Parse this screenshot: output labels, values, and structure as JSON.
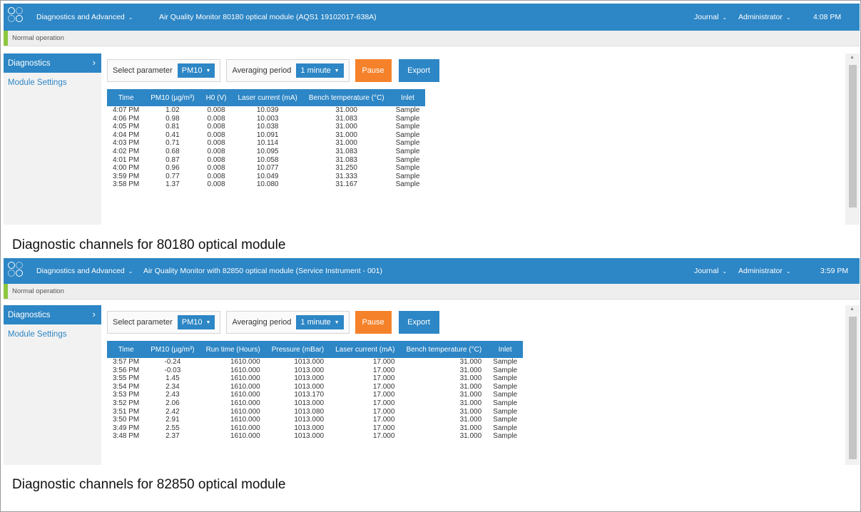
{
  "colors": {
    "accent": "#2d86c5",
    "pause": "#f5822a",
    "status_ok": "#8dc63f"
  },
  "panels": [
    {
      "topbar": {
        "menu": "Diagnostics and Advanced",
        "title": "Air Quality Monitor 80180 optical module (AQS1 19102017-638A)",
        "journal": "Journal",
        "user": "Administrator",
        "time": "4:08 PM"
      },
      "status": "Normal operation",
      "sidebar": {
        "diagnostics": "Diagnostics",
        "module_settings": "Module Settings"
      },
      "controls": {
        "select_parameter_label": "Select parameter",
        "parameter_value": "PM10",
        "averaging_label": "Averaging period",
        "averaging_value": "1 minute",
        "pause_label": "Pause",
        "export_label": "Export"
      },
      "table": {
        "headers": [
          "Time",
          "PM10 (µg/m³)",
          "H0 (V)",
          "Laser current (mA)",
          "Bench temperature (°C)",
          "Inlet"
        ],
        "rows": [
          [
            "4:07 PM",
            "1.02",
            "0.008",
            "10.039",
            "31.000",
            "Sample"
          ],
          [
            "4:06 PM",
            "0.98",
            "0.008",
            "10.003",
            "31.083",
            "Sample"
          ],
          [
            "4:05 PM",
            "0.81",
            "0.008",
            "10.038",
            "31.000",
            "Sample"
          ],
          [
            "4:04 PM",
            "0.41",
            "0.008",
            "10.091",
            "31.000",
            "Sample"
          ],
          [
            "4:03 PM",
            "0.71",
            "0.008",
            "10.114",
            "31.000",
            "Sample"
          ],
          [
            "4:02 PM",
            "0.68",
            "0.008",
            "10.095",
            "31.083",
            "Sample"
          ],
          [
            "4:01 PM",
            "0.87",
            "0.008",
            "10.058",
            "31.083",
            "Sample"
          ],
          [
            "4:00 PM",
            "0.96",
            "0.008",
            "10.077",
            "31.250",
            "Sample"
          ],
          [
            "3:59 PM",
            "0.77",
            "0.008",
            "10.049",
            "31.333",
            "Sample"
          ],
          [
            "3:58 PM",
            "1.37",
            "0.008",
            "10.080",
            "31.167",
            "Sample"
          ]
        ]
      },
      "caption": "Diagnostic channels for 80180 optical module"
    },
    {
      "topbar": {
        "menu": "Diagnostics and Advanced",
        "title": "Air Quality Monitor with 82850 optical module (Service Instrument - 001)",
        "journal": "Journal",
        "user": "Administrator",
        "time": "3:59 PM"
      },
      "status": "Normal operation",
      "sidebar": {
        "diagnostics": "Diagnostics",
        "module_settings": "Module Settings"
      },
      "controls": {
        "select_parameter_label": "Select parameter",
        "parameter_value": "PM10",
        "averaging_label": "Averaging period",
        "averaging_value": "1 minute",
        "pause_label": "Pause",
        "export_label": "Export"
      },
      "table": {
        "headers": [
          "Time",
          "PM10 (µg/m³)",
          "Run time (Hours)",
          "Pressure (mBar)",
          "Laser current (mA)",
          "Bench temperature (°C)",
          "Inlet"
        ],
        "rows": [
          [
            "3:57 PM",
            "-0.24",
            "1610.000",
            "1013.000",
            "17.000",
            "31.000",
            "Sample"
          ],
          [
            "3:56 PM",
            "-0.03",
            "1610.000",
            "1013.000",
            "17.000",
            "31.000",
            "Sample"
          ],
          [
            "3:55 PM",
            "1.45",
            "1610.000",
            "1013.000",
            "17.000",
            "31.000",
            "Sample"
          ],
          [
            "3:54 PM",
            "2.34",
            "1610.000",
            "1013.000",
            "17.000",
            "31.000",
            "Sample"
          ],
          [
            "3:53 PM",
            "2.43",
            "1610.000",
            "1013.170",
            "17.000",
            "31.000",
            "Sample"
          ],
          [
            "3:52 PM",
            "2.06",
            "1610.000",
            "1013.000",
            "17.000",
            "31.000",
            "Sample"
          ],
          [
            "3:51 PM",
            "2.42",
            "1610.000",
            "1013.080",
            "17.000",
            "31.000",
            "Sample"
          ],
          [
            "3:50 PM",
            "2.91",
            "1610.000",
            "1013.000",
            "17.000",
            "31.000",
            "Sample"
          ],
          [
            "3:49 PM",
            "2.55",
            "1610.000",
            "1013.000",
            "17.000",
            "31.000",
            "Sample"
          ],
          [
            "3:48 PM",
            "2.37",
            "1610.000",
            "1013.000",
            "17.000",
            "31.000",
            "Sample"
          ]
        ]
      },
      "caption": "Diagnostic channels for 82850 optical module"
    }
  ]
}
